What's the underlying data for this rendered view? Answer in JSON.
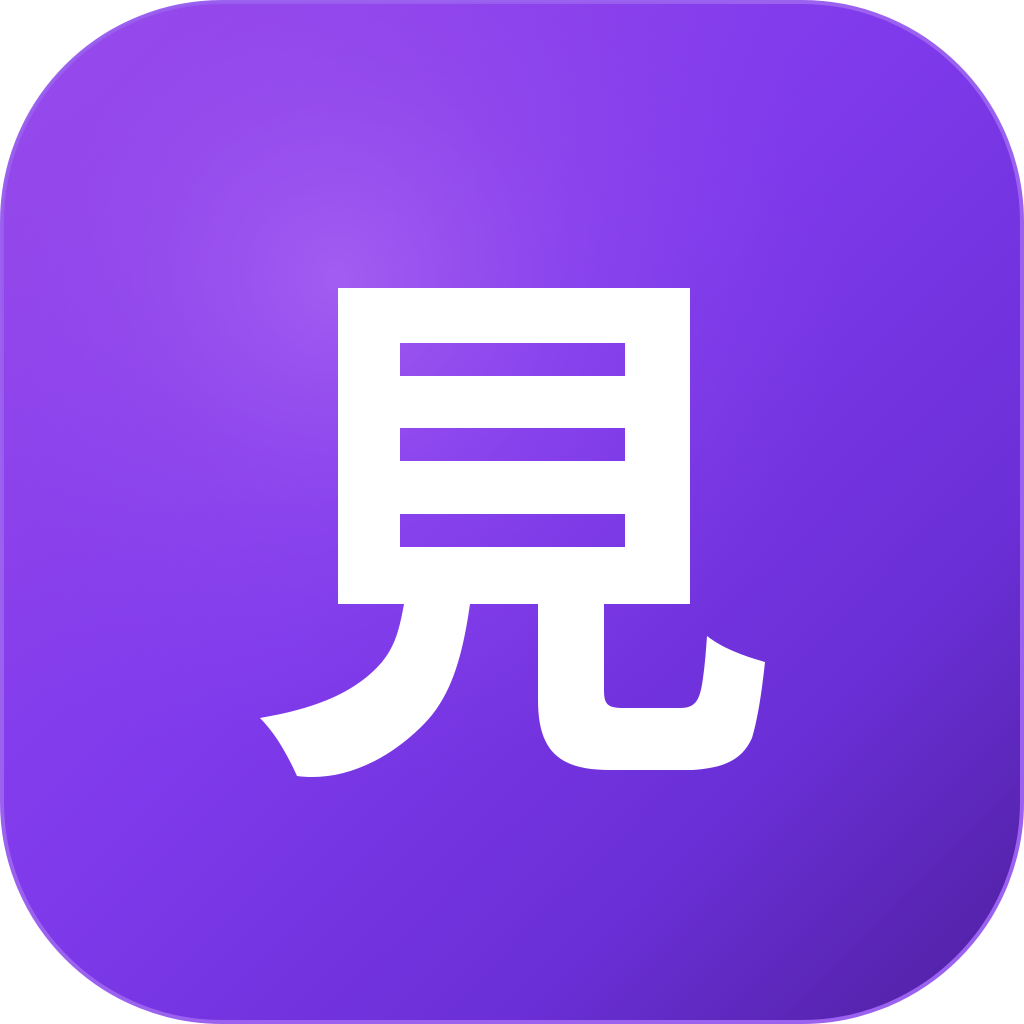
{
  "icon": {
    "glyph": "見",
    "glyph_color": "#ffffff",
    "background": {
      "style": "rounded-square-gradient",
      "colors": [
        "#9a58ee",
        "#8a40ea",
        "#7a38e6",
        "#5a22ac"
      ],
      "highlight_color": "#a15cf0",
      "border_color": "#9356ea"
    }
  }
}
